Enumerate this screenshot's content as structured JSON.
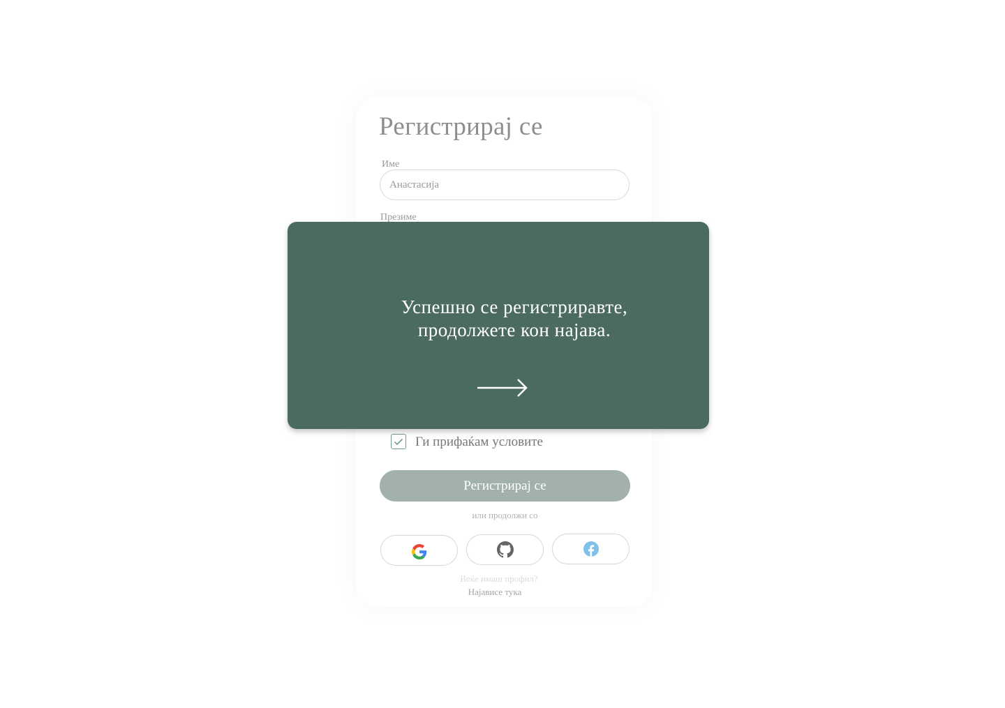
{
  "form": {
    "title": "Регистрирај се",
    "first_name": {
      "label": "Име",
      "value": "Анастасија"
    },
    "last_name": {
      "label": "Презиме"
    },
    "terms": {
      "label": "Ги прифаќам условите",
      "checked": true
    },
    "submit_label": "Регистрирај се",
    "or_continue": "или продолжи со",
    "social": [
      {
        "icon": "google-icon"
      },
      {
        "icon": "github-icon"
      },
      {
        "icon": "facebook-icon"
      }
    ],
    "have_account": "Веќе имаш профил?",
    "login_link": "Најависе тука"
  },
  "modal": {
    "line1": "Успешно се регистриравте,",
    "line2": "продолжете кон најава.",
    "arrow_icon": "arrow-right-icon",
    "background": "#4b6b60"
  },
  "colors": {
    "accent": "#4b6b60",
    "button_disabled": "#a2b1ab",
    "facebook": "#7ec0e6"
  }
}
